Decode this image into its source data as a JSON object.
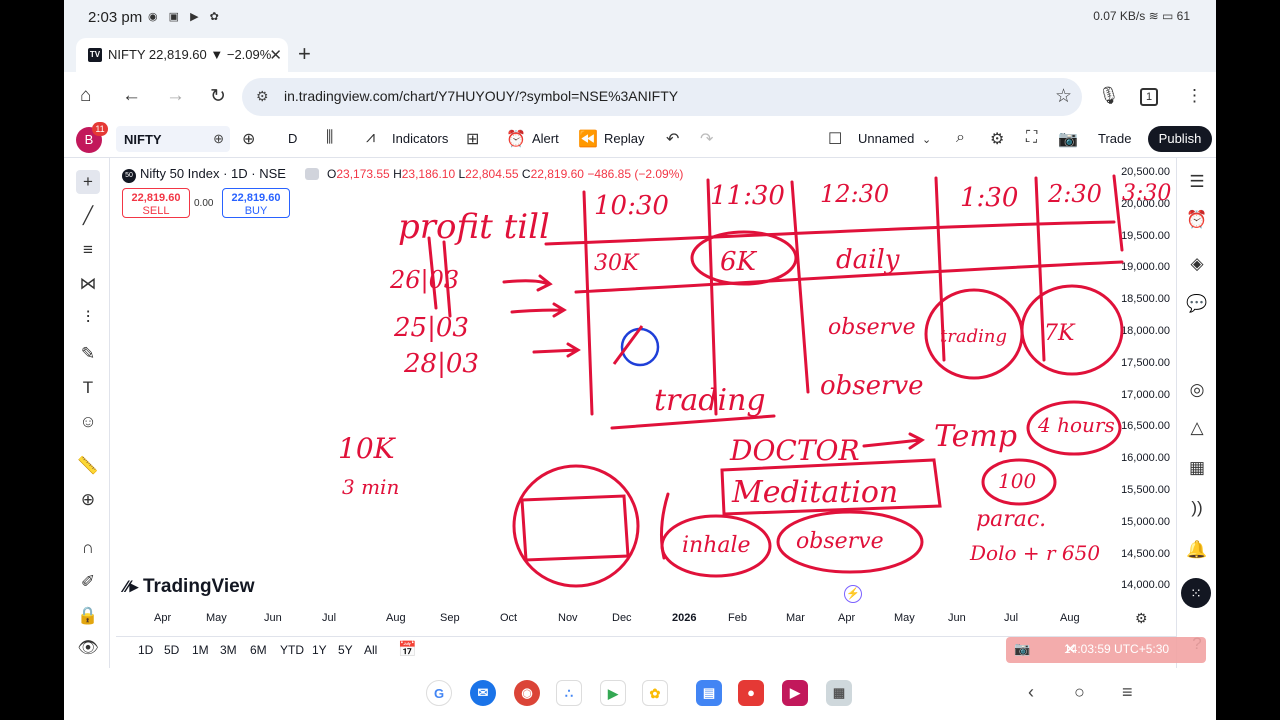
{
  "status": {
    "time": "2:03 pm",
    "net_speed": "0.07 KB/s",
    "battery": "61"
  },
  "tab": {
    "title": "NIFTY 22,819.60 ▼ −2.09%"
  },
  "urlbar": {
    "url": "in.tradingview.com/chart/Y7HUYOUY/?symbol=NSE%3ANIFTY",
    "tab_count": "1"
  },
  "toolbar": {
    "avatar_letter": "B",
    "notification_count": "11",
    "symbol": "NIFTY",
    "interval": "D",
    "indicators_label": "Indicators",
    "alert_label": "Alert",
    "replay_label": "Replay",
    "layout_name": "Unnamed",
    "trade_label": "Trade",
    "publish_label": "Publish"
  },
  "legend": {
    "title": "Nifty 50 Index · 1D · NSE",
    "open_label": "O",
    "open": "23,173.55",
    "high_label": "H",
    "high": "23,186.10",
    "low_label": "L",
    "low": "22,804.55",
    "close_label": "C",
    "close": "22,819.60",
    "change": "−486.85 (−2.09%)"
  },
  "trade": {
    "sell_price": "22,819.60",
    "sell_label": "SELL",
    "spread": "0.00",
    "buy_price": "22,819.60",
    "buy_label": "BUY"
  },
  "brand": "TradingView",
  "price_scale": [
    "20,500.00",
    "20,000.00",
    "19,500.00",
    "19,000.00",
    "18,500.00",
    "18,000.00",
    "17,500.00",
    "17,000.00",
    "16,500.00",
    "16,000.00",
    "15,500.00",
    "15,000.00",
    "14,500.00",
    "14,000.00"
  ],
  "time_axis": [
    "Apr",
    "May",
    "Jun",
    "Jul",
    "Aug",
    "Sep",
    "Oct",
    "Nov",
    "Dec",
    "2026",
    "Feb",
    "Mar",
    "Apr",
    "May",
    "Jun",
    "Jul",
    "Aug"
  ],
  "ranges": [
    "1D",
    "5D",
    "1M",
    "3M",
    "6M",
    "YTD",
    "1Y",
    "5Y",
    "All"
  ],
  "clock": "14:03:59 UTC+5:30",
  "colors": {
    "ink_red": "#e0113a",
    "ink_blue": "#1f3fd8",
    "sell": "#f23645",
    "buy": "#2962ff"
  },
  "handwriting": {
    "profit_till": "profit till",
    "dates": [
      "26|03",
      "25|03",
      "28|03"
    ],
    "times": [
      "10:30",
      "11:30",
      "12:30",
      "1:30",
      "2:30",
      "3:30"
    ],
    "row1_a": "30K",
    "row1_b": "6K",
    "row1_c": "daily",
    "observe_1": "observe",
    "observe_2": "observe",
    "trading_1": "trading",
    "trading_2": "trading",
    "circle_7k": "7K",
    "left_note_1": "10K",
    "left_note_2": "3 min",
    "doctor": "DOCTOR",
    "temp": "Temp",
    "hours": "4 hours",
    "meditation": "Meditation",
    "inhale": "inhale",
    "observe_3": "observe",
    "circle_100": "100",
    "parac": "parac.",
    "dolo": "Dolo + r 650"
  }
}
